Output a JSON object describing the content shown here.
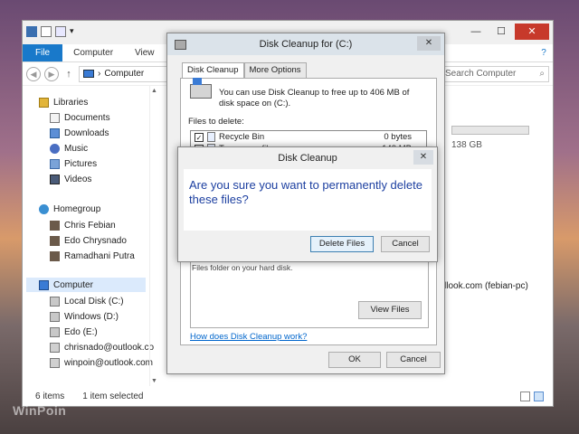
{
  "explorer": {
    "title": "",
    "ribbon_tabs": [
      "File",
      "Computer",
      "View"
    ],
    "help_glyph": "?",
    "window_controls": {
      "minimize": "—",
      "maximize": "☐",
      "close": "✕"
    },
    "address": "Computer",
    "search_placeholder": "Search Computer",
    "nav": {
      "libraries": "Libraries",
      "library_items": [
        "Documents",
        "Downloads",
        "Music",
        "Pictures",
        "Videos"
      ],
      "homegroup": "Homegroup",
      "homegroup_items": [
        "Chris Febian",
        "Edo Chrysnado",
        "Ramadhani Putra"
      ],
      "computer": "Computer",
      "computer_items": [
        "Local Disk (C:)",
        "Windows (D:)",
        "Edo (E:)",
        "chrisnado@outlook.co",
        "winpoin@outlook.com"
      ]
    },
    "right_pane": {
      "drive_size": "138 GB",
      "network_item": "llook.com (febian-pc)"
    },
    "status": {
      "items": "6 items",
      "selected": "1 item selected"
    }
  },
  "disk_cleanup": {
    "title": "Disk Cleanup for  (C:)",
    "close_glyph": "✕",
    "tabs": [
      "Disk Cleanup",
      "More Options"
    ],
    "intro": "You can use Disk Cleanup to free up to 406 MB of disk space on  (C:).",
    "files_to_delete_label": "Files to delete:",
    "files": [
      {
        "name": "Recycle Bin",
        "size": "0 bytes",
        "checked": true
      },
      {
        "name": "Temporary files",
        "size": "149 MB",
        "checked": true
      }
    ],
    "check_glyph": "✓",
    "description_partial": "Files folder on your hard disk.",
    "view_files_label": "View Files",
    "help_link": "How does Disk Cleanup work?",
    "ok_label": "OK",
    "cancel_label": "Cancel"
  },
  "confirm": {
    "title": "Disk Cleanup",
    "close_glyph": "✕",
    "message": "Are you sure you want to permanently delete these files?",
    "delete_label": "Delete Files",
    "cancel_label": "Cancel"
  },
  "watermark": "WinPoin"
}
